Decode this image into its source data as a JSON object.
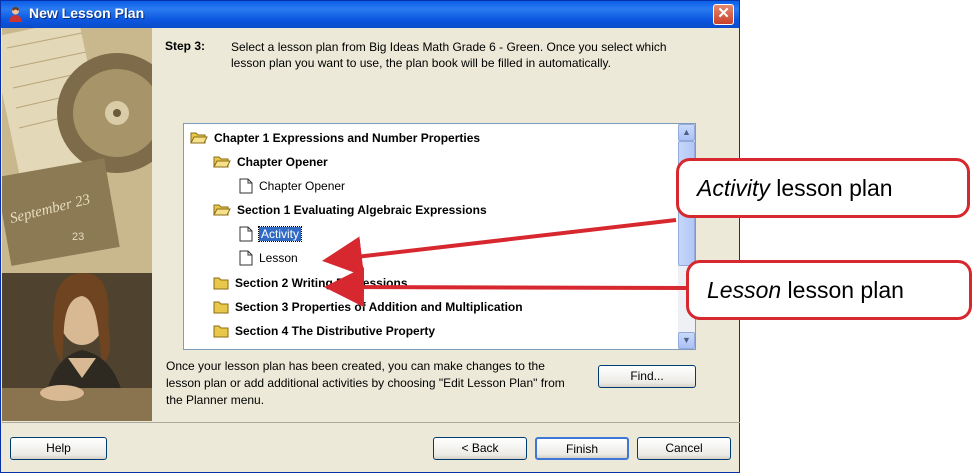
{
  "window": {
    "title": "New Lesson Plan",
    "close_glyph": "✕"
  },
  "step": {
    "label": "Step 3:",
    "text": "Select a lesson plan from Big Ideas Math Grade 6 - Green.  Once you select which lesson plan you want to use, the plan book will be filled in automatically."
  },
  "photo": {
    "calendar_text": "September 23",
    "small_number": "23"
  },
  "tree": {
    "items": [
      {
        "label": "Chapter 1 Expressions and Number Properties",
        "icon": "folder-open-icon"
      },
      {
        "label": "Chapter Opener",
        "icon": "folder-open-icon"
      },
      {
        "label": "Chapter Opener",
        "icon": "document-icon"
      },
      {
        "label": "Section 1 Evaluating Algebraic Expressions",
        "icon": "folder-open-icon"
      },
      {
        "label": "Activity",
        "icon": "document-icon",
        "selected": true
      },
      {
        "label": "Lesson",
        "icon": "document-icon"
      },
      {
        "label": "Section 2 Writing Expressions",
        "icon": "folder-closed-icon"
      },
      {
        "label": "Section 3 Properties of Addition and Multiplication",
        "icon": "folder-closed-icon"
      },
      {
        "label": "Section 4 The Distributive Property",
        "icon": "folder-closed-icon"
      }
    ]
  },
  "note": "Once your lesson plan has been created, you can make changes to the lesson plan or add additional activities by choosing \"Edit Lesson Plan\" from the Planner menu.",
  "buttons": {
    "find": "Find...",
    "help": "Help",
    "back": "< Back",
    "finish": "Finish",
    "cancel": "Cancel"
  },
  "callouts": {
    "activity_em": "Activity",
    "activity_rest": " lesson plan",
    "lesson_em": "Lesson",
    "lesson_rest": " lesson plan"
  },
  "colors": {
    "callout_border": "#d7282f",
    "titlebar": "#0a5ee8",
    "selection": "#316ac5"
  }
}
